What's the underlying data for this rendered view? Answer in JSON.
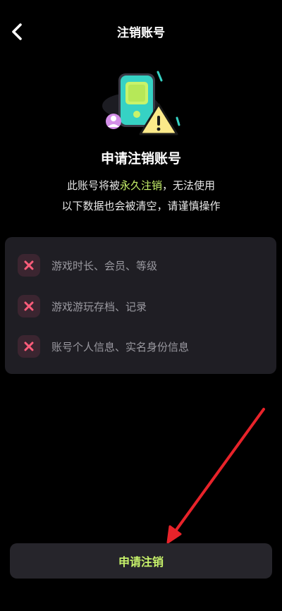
{
  "header": {
    "title": "注销账号",
    "back_icon": "chevron-left-icon"
  },
  "illustration": {
    "icons": [
      "phone-device-icon",
      "warning-triangle-icon",
      "user-avatar-icon"
    ]
  },
  "main": {
    "title": "申请注销账号",
    "desc_line1_prefix": "此账号将被",
    "desc_line1_highlight": "永久注销",
    "desc_line1_suffix": "，无法使用",
    "desc_line2": "以下数据也会被清空，请谨慎操作"
  },
  "info_items": [
    {
      "label": "游戏时长、会员、等级",
      "icon": "close-icon"
    },
    {
      "label": "游戏游玩存档、记录",
      "icon": "close-icon"
    },
    {
      "label": "账号个人信息、实名身份信息",
      "icon": "close-icon"
    }
  ],
  "footer": {
    "apply_label": "申请注销"
  },
  "colors": {
    "background": "#000000",
    "accent_green": "#c8f36b",
    "card_bg": "#1f1e24",
    "x_red": "#ff5c7a",
    "arrow_red": "#e8232a"
  }
}
